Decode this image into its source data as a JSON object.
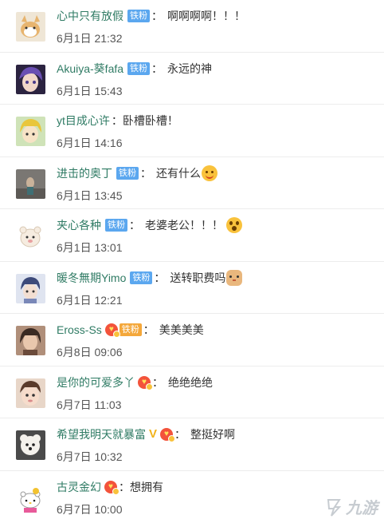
{
  "comments": [
    {
      "username": "心中只有放假",
      "badge": "铁粉",
      "badge_type": "blue",
      "text": "啊啊啊啊！！！",
      "emoji": "",
      "time": "6月1日 21:32",
      "avatar": "cartoon-dog-avatar"
    },
    {
      "username": "Akuiya-葵fafa",
      "badge": "铁粉",
      "badge_type": "blue",
      "text": "永远的神",
      "emoji": "",
      "time": "6月1日 15:43",
      "avatar": "anime-purple-hair-avatar"
    },
    {
      "username": "yt目成心许",
      "badge": "",
      "badge_type": "",
      "text": "卧槽卧槽！",
      "emoji": "",
      "time": "6月1日 14:16",
      "avatar": "anime-blonde-avatar"
    },
    {
      "username": "进击的奥丁",
      "badge": "铁粉",
      "badge_type": "blue",
      "text": "还有什么",
      "emoji": "smile",
      "time": "6月1日 13:45",
      "avatar": "figure-photo-avatar"
    },
    {
      "username": "夹心各种",
      "badge": "铁粉",
      "badge_type": "blue",
      "text": "老婆老公！！！",
      "emoji": "shock",
      "time": "6月1日 13:01",
      "avatar": "cartoon-bear-avatar"
    },
    {
      "username": "暖冬無期Yimo",
      "badge": "铁粉",
      "badge_type": "blue",
      "text": "送转职费吗",
      "emoji": "cat",
      "time": "6月1日 12:21",
      "avatar": "anime-boy-avatar"
    },
    {
      "username": "Eross-Ss",
      "badge": "铁粉",
      "badge_type": "gold",
      "text": "美美美美",
      "emoji": "",
      "time": "6月8日 09:06",
      "avatar": "girl-photo-avatar",
      "fan_icon": true
    },
    {
      "username": "是你的可爱多丫",
      "badge": "",
      "badge_type": "",
      "text": "绝绝绝绝",
      "emoji": "",
      "time": "6月7日 11:03",
      "avatar": "baby-photo-avatar",
      "fan_icon": true
    },
    {
      "username": "希望我明天就暴富",
      "badge": "",
      "badge_type": "",
      "text": "整挺好啊",
      "emoji": "",
      "time": "6月7日 10:32",
      "avatar": "white-dog-avatar",
      "fan_icon": true,
      "vip": "V"
    },
    {
      "username": "古灵金幻",
      "badge": "",
      "badge_type": "",
      "text": "想拥有",
      "emoji": "",
      "time": "6月7日 10:00",
      "avatar": "hello-kitty-avatar",
      "fan_icon": true
    }
  ],
  "punctuation": {
    "colon": "："
  },
  "watermark": {
    "text": "九游"
  },
  "colors": {
    "username": "#2f7b64",
    "badge_blue": "#5ba7ef",
    "badge_gold": "#f4a73a",
    "divider": "#ececec"
  }
}
